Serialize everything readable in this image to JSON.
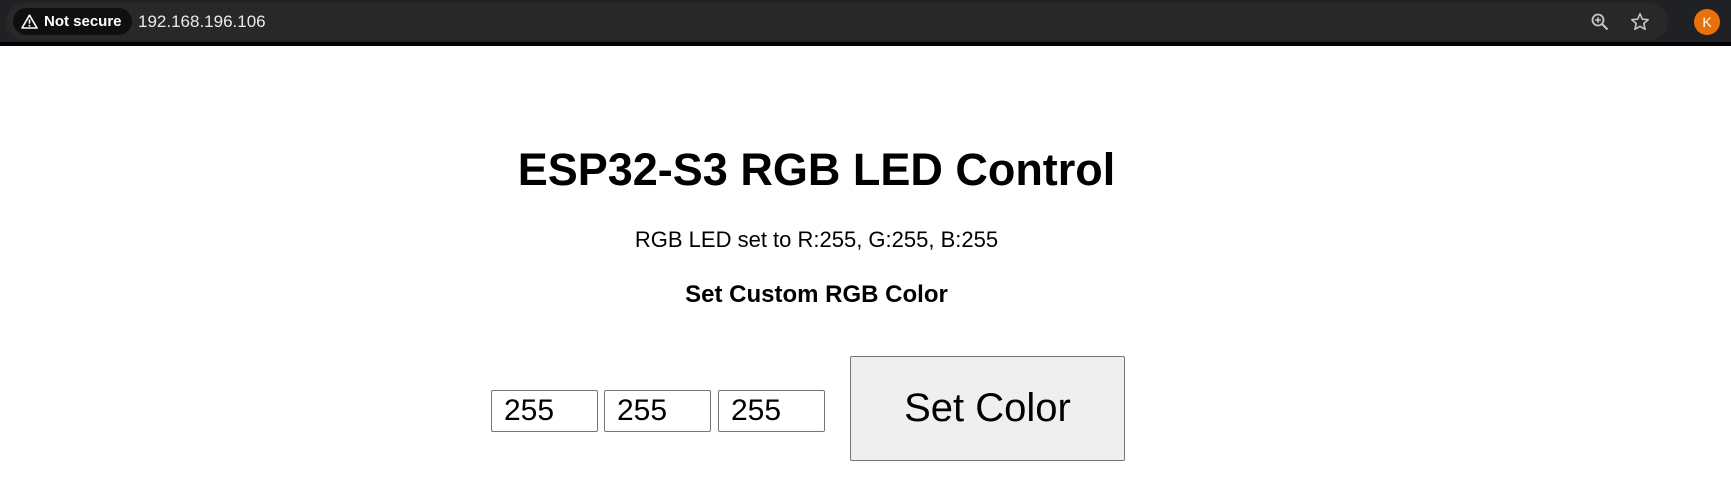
{
  "browser": {
    "security_label": "Not secure",
    "url": "192.168.196.106",
    "profile_initial": "K",
    "icons": {
      "security": "warning-triangle-icon",
      "zoom": "zoom-in-icon",
      "bookmark": "star-icon"
    },
    "colors": {
      "toolbar": "#202124",
      "avatar": "#e8710a"
    }
  },
  "page": {
    "title": "ESP32-S3 RGB LED Control",
    "status": "RGB LED set to R:255, G:255, B:255",
    "form_heading": "Set Custom RGB Color",
    "inputs": {
      "red": "255",
      "green": "255",
      "blue": "255"
    },
    "submit_label": "Set Color"
  }
}
